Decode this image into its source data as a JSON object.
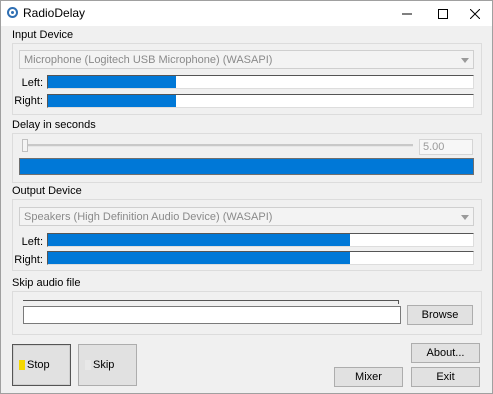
{
  "window": {
    "title": "RadioDelay"
  },
  "input": {
    "heading": "Input Device",
    "device": "Microphone (Logitech USB Microphone) (WASAPI)",
    "left_label": "Left:",
    "right_label": "Right:",
    "left_level": 0.3,
    "right_level": 0.3
  },
  "delay": {
    "heading": "Delay in seconds",
    "value": "5.00",
    "buffer_level": 1.0
  },
  "output": {
    "heading": "Output Device",
    "device": "Speakers (High Definition Audio Device) (WASAPI)",
    "left_label": "Left:",
    "right_label": "Right:",
    "left_level": 0.71,
    "right_level": 0.71
  },
  "skip": {
    "heading": "Skip audio file",
    "path": "",
    "browse_label": "Browse"
  },
  "buttons": {
    "stop": "Stop",
    "skip": "Skip",
    "about": "About...",
    "mixer": "Mixer",
    "exit": "Exit"
  },
  "colors": {
    "meter_fill": "#0078d7",
    "stop_led": "#f5d800",
    "skip_led": "#e8e8e8"
  }
}
